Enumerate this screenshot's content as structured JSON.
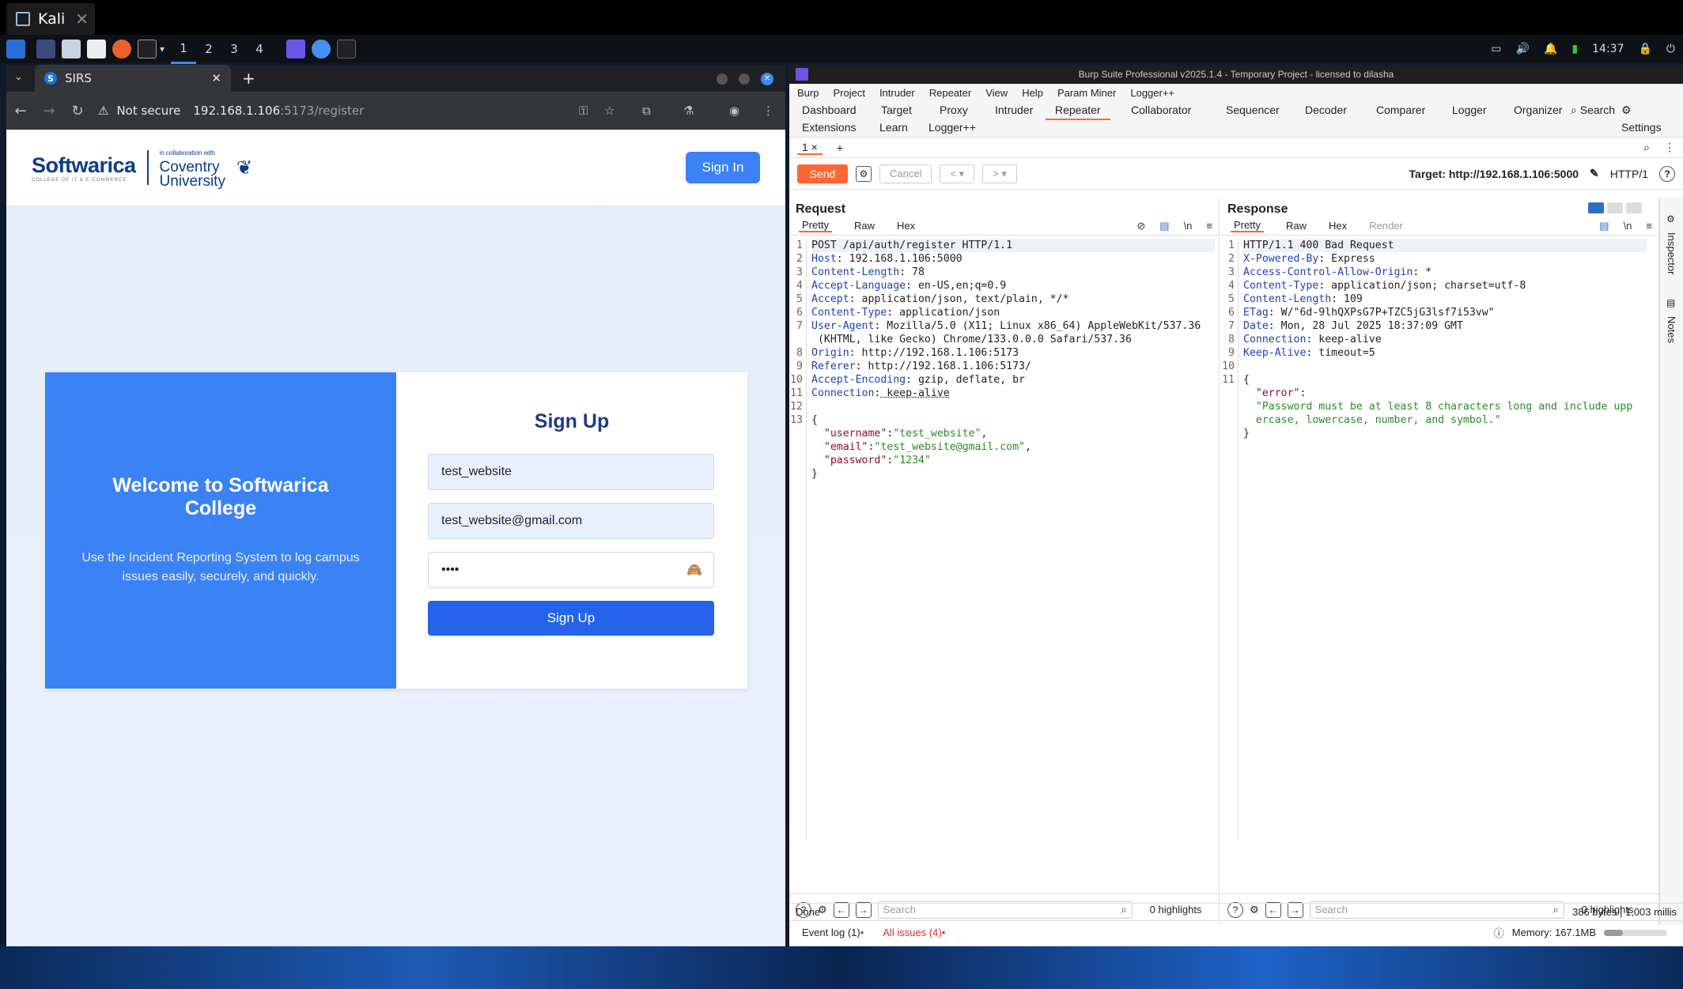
{
  "host": {
    "tab_title": "Kali",
    "workspaces": [
      "1",
      "2",
      "3",
      "4"
    ],
    "clock": "14:37"
  },
  "chrome": {
    "tab_title": "SIRS",
    "favicon_letter": "S",
    "not_secure": "Not secure",
    "url_host": "192.168.1.106",
    "url_path": ":5173/register"
  },
  "site": {
    "logo_main": "Softwarica",
    "logo_sub": "COLLEGE OF IT & E-COMMERCE",
    "logo_partner_tag": "in collaboration with",
    "logo_partner_1": "Coventry",
    "logo_partner_2": "University",
    "signin_label": "Sign In",
    "welcome_title": "Welcome to Softwarica College",
    "welcome_text": "Use the Incident Reporting System to log campus issues easily, securely, and quickly.",
    "form_title": "Sign Up",
    "username_value": "test_website",
    "email_value": "test_website@gmail.com",
    "password_mask": "••••",
    "signup_label": "Sign Up"
  },
  "burp": {
    "title": "Burp Suite Professional v2025.1.4 - Temporary Project - licensed to dilasha",
    "menu": [
      "Burp",
      "Project",
      "Intruder",
      "Repeater",
      "View",
      "Help",
      "Param Miner",
      "Logger++"
    ],
    "tabs_row1": [
      "Dashboard",
      "Target",
      "Proxy",
      "Intruder",
      "Repeater",
      "Collaborator",
      "Sequencer",
      "Decoder",
      "Comparer",
      "Logger",
      "Organizer"
    ],
    "tabs_row2": [
      "Extensions",
      "Learn",
      "Logger++"
    ],
    "search_label": "Search",
    "settings_label": "Settings",
    "repeater_tab": "1 ×",
    "send": "Send",
    "cancel": "Cancel",
    "target": "Target: http://192.168.1.106:5000",
    "http_version": "HTTP/1",
    "request_title": "Request",
    "response_title": "Response",
    "req_views": [
      "Pretty",
      "Raw",
      "Hex"
    ],
    "res_views": [
      "Pretty",
      "Raw",
      "Hex",
      "Render"
    ],
    "search_placeholder": "Search",
    "highlights": "0 highlights",
    "status": "Done",
    "status_right": "386 bytes | 1,003 millis",
    "event_log": "Event log (1)",
    "all_issues": "All issues (4)",
    "memory": "Memory: 167.1MB",
    "inspector": "Inspector",
    "notes": "Notes"
  },
  "request": {
    "line1": "POST /api/auth/register HTTP/1.1",
    "headers": [
      {
        "k": "Host",
        "v": " 192.168.1.106:5000"
      },
      {
        "k": "Content-Length",
        "v": " 78"
      },
      {
        "k": "Accept-Language",
        "v": " en-US,en;q=0.9"
      },
      {
        "k": "Accept",
        "v": " application/json, text/plain, */*"
      },
      {
        "k": "Content-Type",
        "v": " application/json"
      },
      {
        "k": "User-Agent",
        "v": " Mozilla/5.0 (X11; Linux x86_64) AppleWebKit/537.36"
      },
      {
        "k": "",
        "v": " (KHTML, like Gecko) Chrome/133.0.0.0 Safari/537.36"
      },
      {
        "k": "Origin",
        "v": " http://192.168.1.106:5173"
      },
      {
        "k": "Referer",
        "v": " http://192.168.1.106:5173/"
      },
      {
        "k": "Accept-Encoding",
        "v": " gzip, deflate, br"
      },
      {
        "k": "Connection",
        "v": " keep-alive"
      }
    ],
    "body_username_k": "\"username\"",
    "body_username_v": "\"test_website\"",
    "body_email_k": "\"email\"",
    "body_email_v": "\"test_website@gmail.com\"",
    "body_password_k": "\"password\"",
    "body_password_v": "\"1234\""
  },
  "response": {
    "line1": "HTTP/1.1 400 Bad Request",
    "headers": [
      {
        "k": "X-Powered-By",
        "v": " Express"
      },
      {
        "k": "Access-Control-Allow-Origin",
        "v": " *"
      },
      {
        "k": "Content-Type",
        "v": " application/json; charset=utf-8"
      },
      {
        "k": "Content-Length",
        "v": " 109"
      },
      {
        "k": "ETag",
        "v": " W/\"6d-9lhQXPsG7P+TZC5jG3lsf7i53vw\""
      },
      {
        "k": "Date",
        "v": " Mon, 28 Jul 2025 18:37:09 GMT"
      },
      {
        "k": "Connection",
        "v": " keep-alive"
      },
      {
        "k": "Keep-Alive",
        "v": " timeout=5"
      }
    ],
    "error_k": "\"error\"",
    "error_v1": "\"Password must be at least 8 characters long and include upp",
    "error_v2": "ercase, lowercase, number, and symbol.\""
  }
}
